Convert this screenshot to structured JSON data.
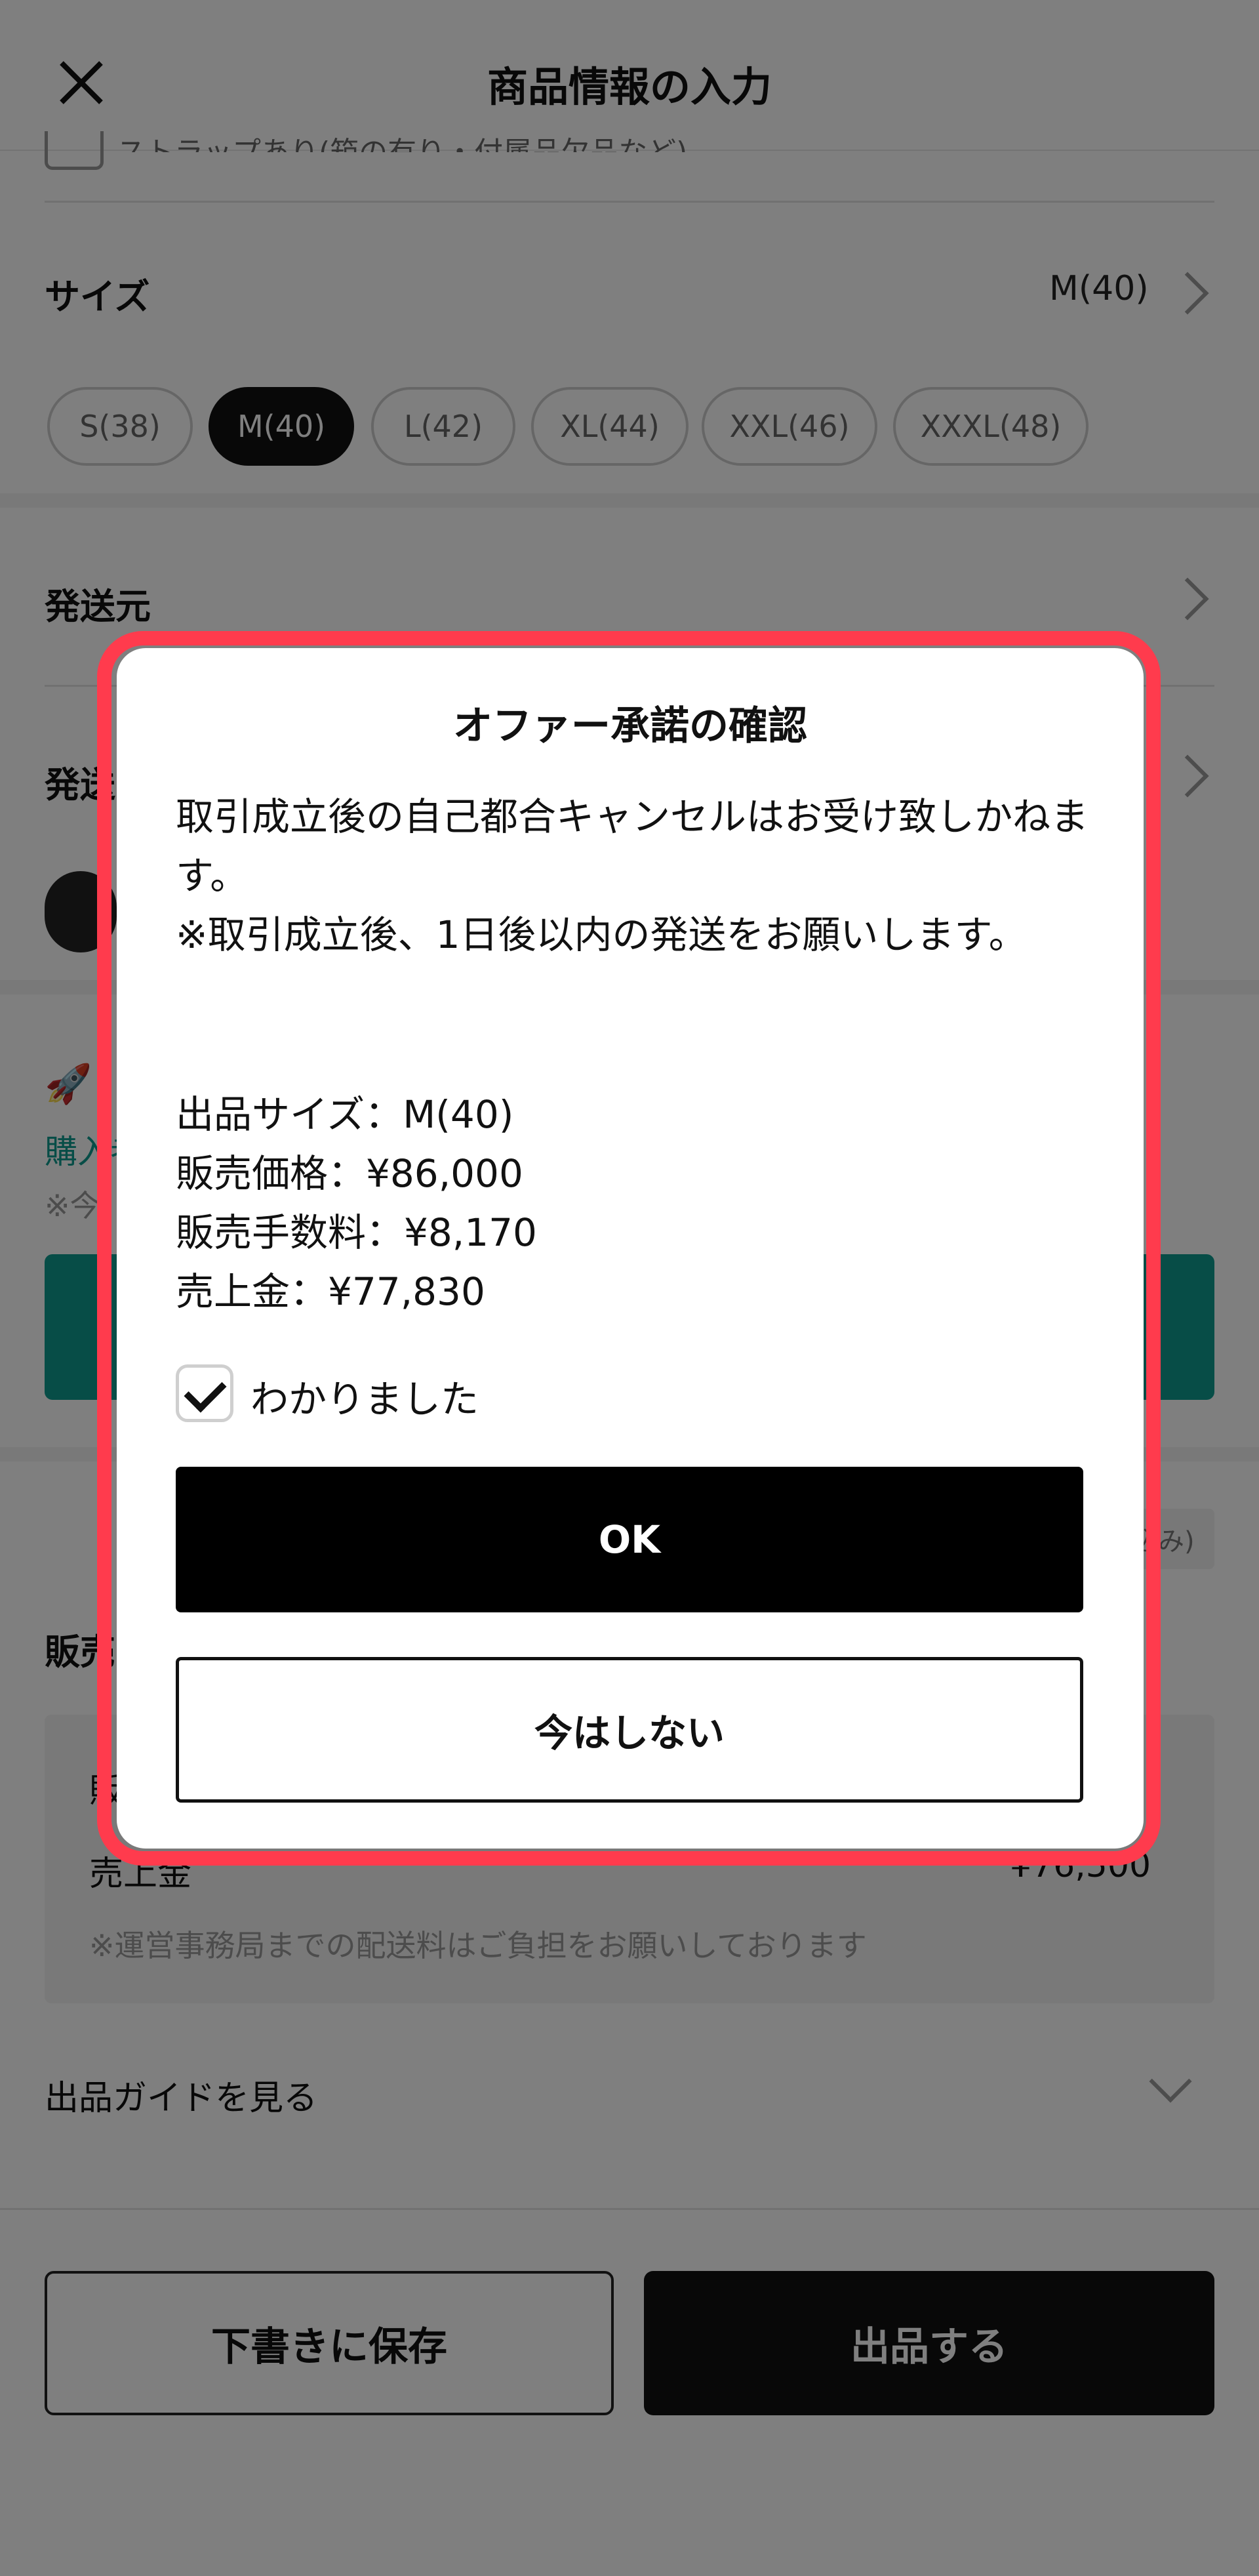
{
  "header": {
    "title": "商品情報の入力"
  },
  "attribute_row": {
    "partial_text": "ストラップあり(箱の有り・付属品欠品など)"
  },
  "size_section": {
    "label": "サイズ",
    "value": "M(40)",
    "options": [
      "S(38)",
      "M(40)",
      "L(42)",
      "XL(44)",
      "XXL(46)",
      "XXXL(48)"
    ],
    "selected": "M(40)"
  },
  "ship_from": {
    "label": "発送元"
  },
  "ship_days": {
    "label_partial": "発送"
  },
  "boost": {
    "link_partial": "購入者",
    "note_partial": "※今"
  },
  "price": {
    "label_partial": "販売",
    "sale_fee_partial": "販",
    "proceeds_label": "売上金",
    "proceeds_value_partial": "¥76,500",
    "shipping_note": "※運営事務局までの配送料はご負担をお願いしております",
    "badge_partial": "(税込み)"
  },
  "guide": {
    "label": "出品ガイドを見る"
  },
  "footer": {
    "save_label": "下書きに保存",
    "submit_label": "出品する"
  },
  "dialog": {
    "title": "オファー承諾の確認",
    "body": "取引成立後の自己都合キャンセルはお受け致しかねます。\n※取引成立後、1日後以内の発送をお願いします。",
    "summary": {
      "size": "出品サイズ：M(40)",
      "price": "販売価格：¥86,000",
      "fee": "販売手数料：¥8,170",
      "proceeds": "売上金：¥77,830"
    },
    "acknowledge_label": "わかりました",
    "acknowledge_checked": true,
    "ok_label": "OK",
    "cancel_label": "今はしない"
  },
  "colors": {
    "highlight": "#ff3b4d",
    "teal": "#0e9a8e",
    "primary": "#000000"
  }
}
